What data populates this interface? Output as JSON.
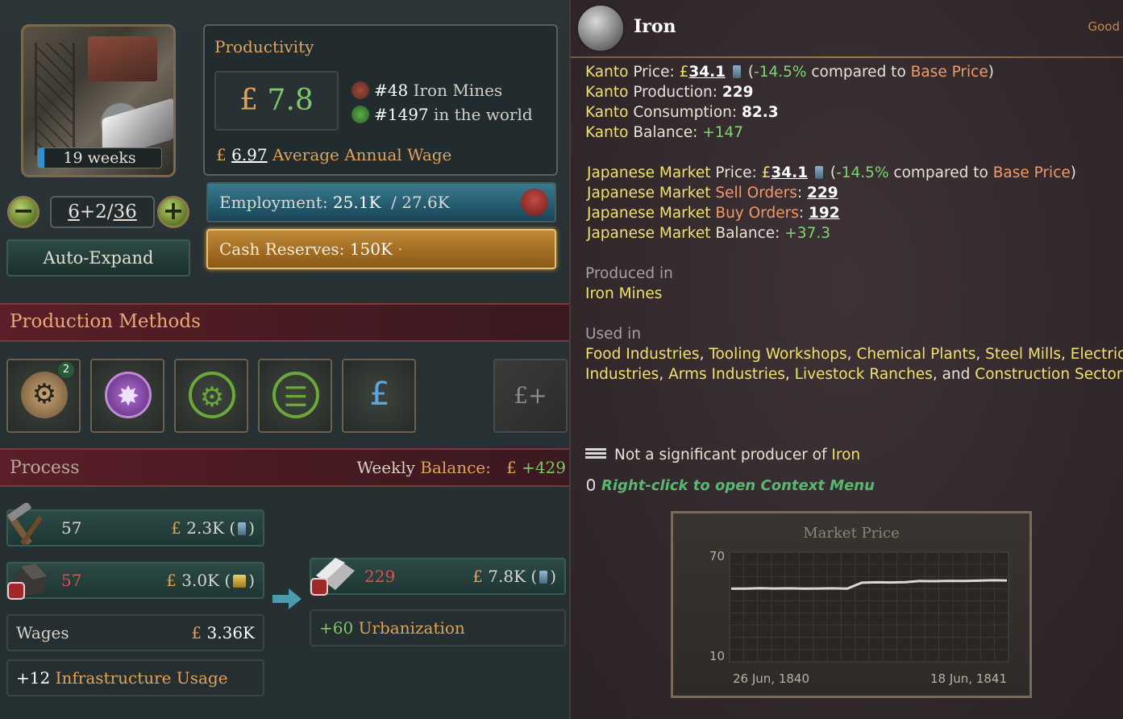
{
  "building": {
    "weeks_label": "19 weeks",
    "level": {
      "current": "6",
      "plus": "+2",
      "max": "36"
    },
    "auto_expand_label": "Auto-Expand"
  },
  "productivity": {
    "title": "Productivity",
    "currency": "£",
    "value": "7.8",
    "rank_national": "#48",
    "rank_national_text": " Iron Mines",
    "rank_world": "#1497",
    "rank_world_text": " in the world",
    "avg_wage_value": "6.97",
    "avg_wage_label": "Average Annual Wage"
  },
  "employment": {
    "label": "Employment:",
    "current": "25.1K",
    "max": "/ 27.6K"
  },
  "cash": {
    "label": "Cash Reserves:",
    "value": "150K",
    "dot": "·"
  },
  "production_methods": {
    "title": "Production Methods",
    "badge": "2",
    "add_label": "£+",
    "slots": [
      {
        "icon": "steam-pump-icon"
      },
      {
        "icon": "explosives-icon"
      },
      {
        "icon": "no-automation-icon"
      },
      {
        "icon": "no-rail-icon"
      },
      {
        "icon": "privately-owned-icon"
      }
    ]
  },
  "process": {
    "title": "Process",
    "weekly_label": "Weekly",
    "balance_label": "Balance:",
    "balance_value": "+429",
    "inputs": [
      {
        "icon": "tools-icon",
        "count": "57",
        "cost": "2.3K",
        "paren_open": "(",
        "paren_close": ")"
      },
      {
        "icon": "coal-icon",
        "count": "57",
        "cost": "3.0K",
        "paren_open": "(",
        "paren_close": ")"
      }
    ],
    "wages_label": "Wages",
    "wages_value": "3.36K",
    "infra_value": "+12",
    "infra_label": "Infrastructure Usage",
    "output": {
      "icon": "iron-icon",
      "count": "229",
      "value": "7.8K",
      "paren_open": "(",
      "paren_close": ")"
    },
    "urban_value": "+60",
    "urban_label": "Urbanization"
  },
  "tooltip": {
    "title": "Iron",
    "category": "Good",
    "kanto": {
      "region": "Kanto",
      "price_label": "Price:",
      "price": "34.1",
      "price_delta": "-14.5%",
      "compared": "compared to",
      "base_price": "Base Price",
      "production_label": "Production:",
      "production": "229",
      "consumption_label": "Consumption:",
      "consumption": "82.3",
      "balance_label": "Balance:",
      "balance": "+147"
    },
    "market": {
      "name": "Japanese Market",
      "price_label": "Price:",
      "price": "34.1",
      "price_delta": "-14.5%",
      "compared": "compared to",
      "base_price": "Base Price",
      "sell_label": "Sell Orders",
      "sell": "229",
      "buy_label": "Buy Orders",
      "buy": "192",
      "balance_label": "Balance:",
      "balance": "+37.3"
    },
    "produced_in_label": "Produced in",
    "produced_in": "Iron Mines",
    "used_in_label": "Used in",
    "used_in_line1": [
      "Food Industries",
      "Tooling Workshops",
      "Chemical Plants",
      "Steel Mills",
      "Electrics"
    ],
    "used_in_line2": [
      "Industries",
      "Arms Industries",
      "Livestock Ranches"
    ],
    "used_in_and": "and",
    "used_in_last": "Construction Sector",
    "not_significant": "Not a significant producer of",
    "not_significant_good": "Iron",
    "hint": "Right-click to open Context Menu"
  },
  "chart_data": {
    "type": "line",
    "title": "Market Price",
    "x_start_label": "26 Jun, 1840",
    "x_end_label": "18 Jun, 1841",
    "ylim": [
      10,
      70
    ],
    "y_ticks": [
      "70",
      "10"
    ],
    "grid": true,
    "series": [
      {
        "color": "#d8d8d8",
        "values": [
          50,
          50,
          50.3,
          50.1,
          50.2,
          50,
          50.1,
          50.2,
          50,
          53.3,
          53.5,
          53.4,
          53.6,
          54.2,
          54.1,
          54.3,
          54.2,
          54.4,
          54.6,
          54.5
        ]
      }
    ]
  },
  "colors": {
    "accent_gold": "#e0a35a",
    "positive": "#7cc86a",
    "negative": "#e0504a"
  }
}
